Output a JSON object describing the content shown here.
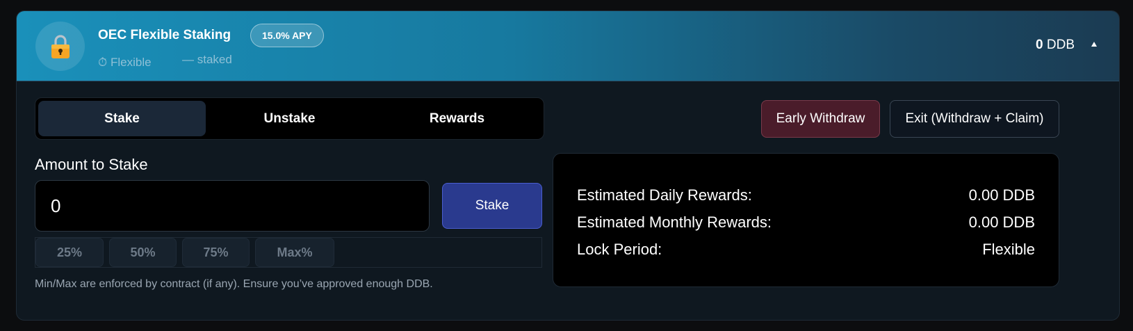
{
  "header": {
    "title": "OEC Flexible Staking",
    "apy_badge": "15.0% APY",
    "lock_type": "⏱ Flexible",
    "staked": "— staked",
    "amount_value": "0",
    "amount_unit": "DDB",
    "lock_icon": "lock-icon",
    "caret_icon": "caret-up-icon"
  },
  "tabs": [
    {
      "label": "Stake",
      "active": true
    },
    {
      "label": "Unstake",
      "active": false
    },
    {
      "label": "Rewards",
      "active": false
    }
  ],
  "actions": {
    "early_withdraw": "Early Withdraw",
    "exit": "Exit (Withdraw + Claim)"
  },
  "stake_form": {
    "label": "Amount to Stake",
    "input_value": "0",
    "stake_button": "Stake",
    "percent_buttons": [
      "25%",
      "50%",
      "75%",
      "Max%"
    ],
    "note": "Min/Max are enforced by contract (if any). Ensure you’ve approved enough DDB."
  },
  "estimates": [
    {
      "label": "Estimated Daily Rewards:",
      "value": "0.00 DDB"
    },
    {
      "label": "Estimated Monthly Rewards:",
      "value": "0.00 DDB"
    },
    {
      "label": "Lock Period:",
      "value": "Flexible"
    }
  ],
  "colors": {
    "header_gradient_start": "#1a90ba",
    "header_gradient_end": "#1b3b52",
    "early_withdraw_bg": "#4a1c2a",
    "stake_button_bg": "#2a3a8e"
  }
}
